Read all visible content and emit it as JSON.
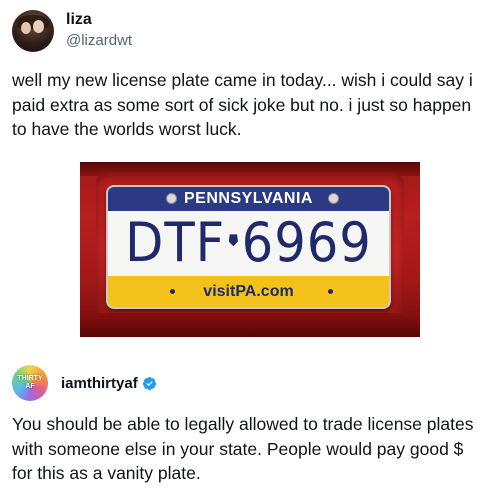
{
  "tweet": {
    "author": {
      "display_name": "liza",
      "handle": "@lizardwt"
    },
    "text": "well my new license plate came in today... wish i could say i paid extra as some sort of sick joke but no. i just so happen to have the worlds worst luck.",
    "image": {
      "plate": {
        "state": "PENNSYLVANIA",
        "number_left": "DTF",
        "number_right": "6969",
        "url": "visitPA.com"
      }
    }
  },
  "reply": {
    "author": {
      "display_name": "iamthirtyaf",
      "avatar_text_top": "THIRTY",
      "avatar_text_bottom": "AF",
      "verified": true
    },
    "text": "You should be able to legally allowed to trade license plates with someone else in your state. People would pay good $ for this as a vanity plate."
  },
  "colors": {
    "plate_blue": "#2b3a83",
    "plate_yellow": "#f2c21b",
    "verified_blue": "#1d9bf0",
    "car_red": "#b81e1e"
  }
}
